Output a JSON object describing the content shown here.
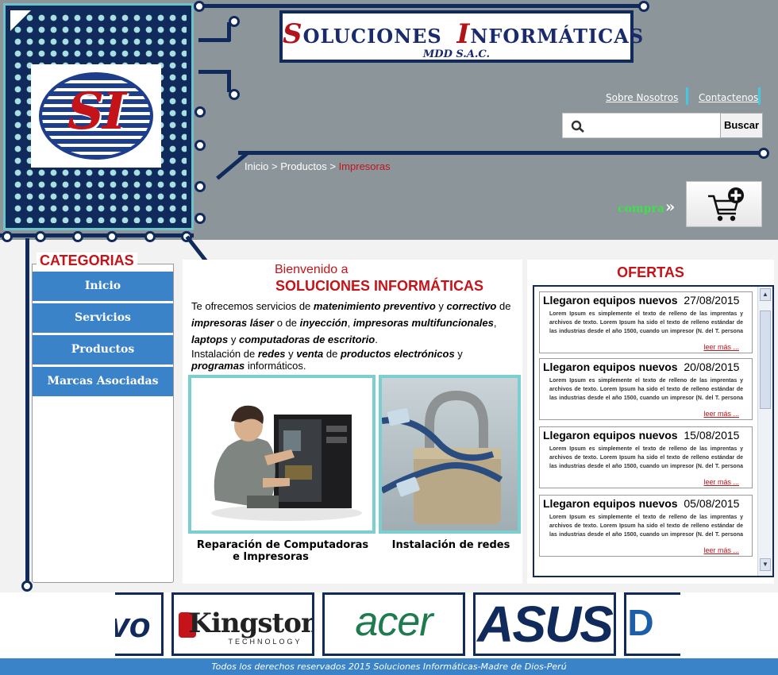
{
  "brand": {
    "logo_letters": "SI",
    "name_cap1": "S",
    "name_rest1": "OLUCIONES",
    "name_cap2": "I",
    "name_rest2": "NFORMÁTICAS",
    "subtitle": "MDD S.A.C."
  },
  "top_links": [
    "Sobre Nosotros",
    "Contactenos"
  ],
  "search": {
    "value": "",
    "button_label": "Buscar",
    "icon": "search-icon"
  },
  "breadcrumb": {
    "home": "Inicio",
    "sep1": " > ",
    "section": "Productos",
    "sep2": " > ",
    "current": "Impresoras"
  },
  "cart": {
    "label": "compra",
    "arrows": "»",
    "icon": "cart-add-icon"
  },
  "categories": {
    "title": "CATEGORIAS",
    "items": [
      "Inicio",
      "Servicios",
      "Productos",
      "Marcas Asociadas"
    ]
  },
  "welcome": {
    "line1": "Bienvenido a",
    "line2": "SOLUCIONES INFORMÁTICAS",
    "p1": {
      "t1": "Te ofrecemos servicios de ",
      "e1": "matenimiento preventivo",
      "t2": " y ",
      "e2": "correctivo",
      "t3": " de ",
      "e3": "impresoras láser",
      "t4": " o de ",
      "e4": "inyección",
      "t5": ", ",
      "e5": "impresoras multifuncionales",
      "t6": ", ",
      "e6": "laptops",
      "t7": " y ",
      "e7": "computadoras de escritorio",
      "t8": "."
    },
    "p2": {
      "t1": "Instalación de ",
      "e1": "redes",
      "t2": " y ",
      "e2": "venta",
      "t3": " de ",
      "e3": "productos electrónicos",
      "t4": " y ",
      "e4": "programas",
      "t5": " informáticos."
    },
    "cards": [
      {
        "caption_line1": "Reparación de Computadoras",
        "caption_line2": "e Impresoras"
      },
      {
        "caption_line1": "Instalación de redes",
        "caption_line2": ""
      }
    ]
  },
  "ofertas": {
    "title": "OFERTAS",
    "items": [
      {
        "title": "Llegaron equipos nuevos",
        "date": "27/08/2015",
        "text": "Lorem Ipsum es simplemente el texto de relleno de las imprentas y archivos de texto. Lorem Ipsum ha sido el texto de relleno estándar de las industrias desde el año 1500, cuando un impresor (N. del T. persona que se dedica a la imprenta) desconocido usó una galería de",
        "more": "leer más ..."
      },
      {
        "title": "Llegaron equipos nuevos",
        "date": "20/08/2015",
        "text": "Lorem Ipsum es simplemente el texto de relleno de las imprentas y archivos de texto. Lorem Ipsum ha sido el texto de relleno estándar de las industrias desde el año 1500, cuando un impresor (N. del T. persona que se dedica a la imprenta) desconocido usó una galería de",
        "more": "leer más ..."
      },
      {
        "title": "Llegaron equipos nuevos",
        "date": "15/08/2015",
        "text": "Lorem Ipsum es simplemente el texto de relleno de las imprentas y archivos de texto. Lorem Ipsum ha sido el texto de relleno estándar de las industrias desde el año 1500, cuando un impresor (N. del T. persona que se dedica a la imprenta) desconocido usó una galería de",
        "more": "leer más ..."
      },
      {
        "title": "Llegaron equipos nuevos",
        "date": "05/08/2015",
        "text": "Lorem Ipsum es simplemente el texto de relleno de las imprentas y archivos de texto. Lorem Ipsum ha sido el texto de relleno estándar de las industrias desde el año 1500, cuando un impresor (N. del T. persona que se dedica a la imprenta) desconocido usó una galería de",
        "more": "leer más ..."
      }
    ]
  },
  "brands": [
    "vo",
    "Kingston",
    "TECHNOLOGY",
    "acer",
    "ASUS",
    "D"
  ],
  "footer": "Todos los derechos reservados 2015 Soluciones Informáticas-Madre de Dios-Perú",
  "colors": {
    "navy": "#112a5c",
    "red": "#c4141a",
    "blue": "#3b83c8",
    "cyan": "#6fc3c7",
    "grey": "#8b959a",
    "green": "#3fe04a"
  }
}
